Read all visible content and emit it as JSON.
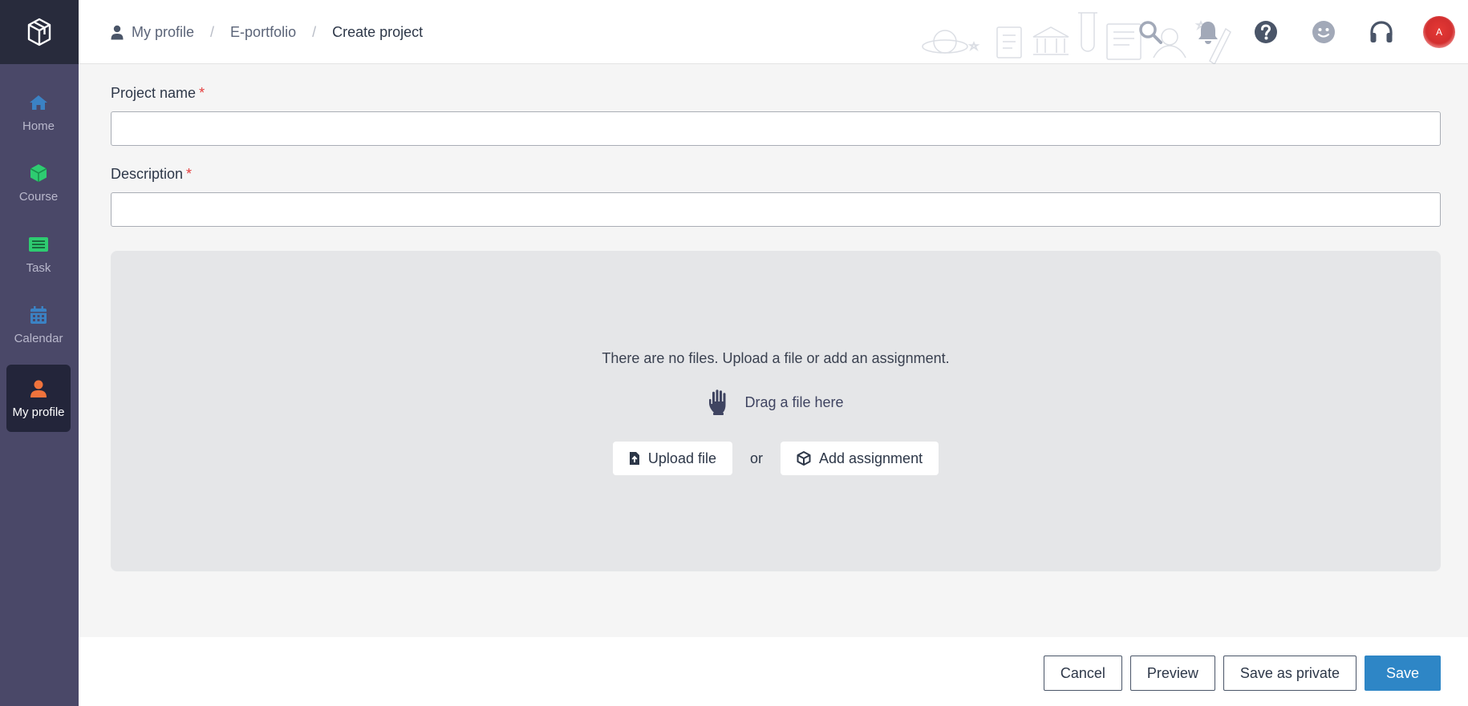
{
  "sidebar": {
    "logo_icon": "cube-logo-icon",
    "items": [
      {
        "label": "Home",
        "icon": "home-icon",
        "color": "#3b82c4"
      },
      {
        "label": "Course",
        "icon": "cube-icon",
        "color": "#2ecc71"
      },
      {
        "label": "Task",
        "icon": "task-list-icon",
        "color": "#2ecc71"
      },
      {
        "label": "Calendar",
        "icon": "calendar-icon",
        "color": "#3b82c4"
      },
      {
        "label": "My profile",
        "icon": "user-icon",
        "color": "#f0733c",
        "active": true
      }
    ]
  },
  "breadcrumb": {
    "items": [
      "My profile",
      "E-portfolio",
      "Create project"
    ],
    "separator": "/"
  },
  "header_icons": [
    "search-icon",
    "bell-icon",
    "help-icon",
    "smiley-icon",
    "headphones-icon"
  ],
  "avatar": {
    "initial": "A",
    "color": "#d32f2f"
  },
  "form": {
    "project_name_label": "Project name",
    "project_name_value": "",
    "description_label": "Description",
    "description_value": "",
    "required_mark": "*"
  },
  "dropzone": {
    "message": "There are no files. Upload a file or add an assignment.",
    "drag_label": "Drag a file here",
    "upload_label": "Upload file",
    "or_label": "or",
    "assignment_label": "Add assignment"
  },
  "footer": {
    "cancel_label": "Cancel",
    "preview_label": "Preview",
    "save_private_label": "Save as private",
    "save_label": "Save"
  },
  "colors": {
    "primary": "#2e86c6",
    "sidebar": "#4a4868",
    "sidebar_dark": "#23253a",
    "required": "#e53e3e"
  }
}
